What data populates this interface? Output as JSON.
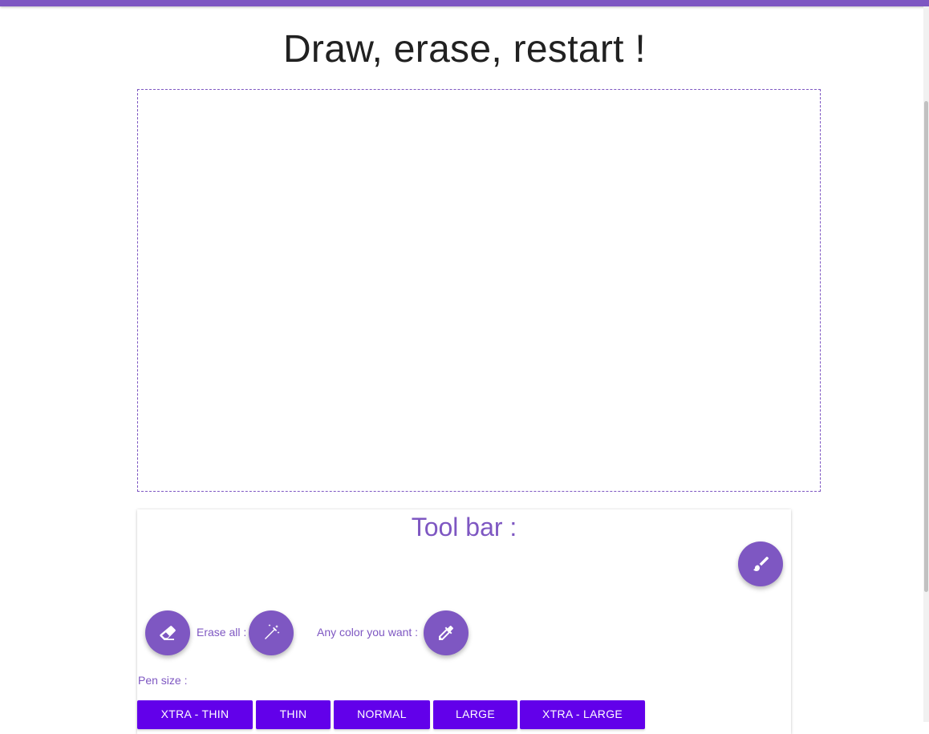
{
  "header": {
    "title": "Draw, erase, restart !",
    "accent_color": "#7e57c2"
  },
  "canvas": {
    "name": "drawing-canvas"
  },
  "toolbar": {
    "title": "Tool bar :",
    "brush_icon": "brush-icon",
    "eraser_icon": "eraser-icon",
    "erase_all_label": "Erase all :",
    "erase_all_icon": "magic-wand-icon",
    "color_label": "Any color you want :",
    "color_icon": "eyedropper-icon",
    "pen_size_label": "Pen size :",
    "pen_sizes": [
      "XTRA - THIN",
      "THIN",
      "NORMAL",
      "LARGE",
      "XTRA - LARGE"
    ],
    "button_color": "#6200ea"
  }
}
